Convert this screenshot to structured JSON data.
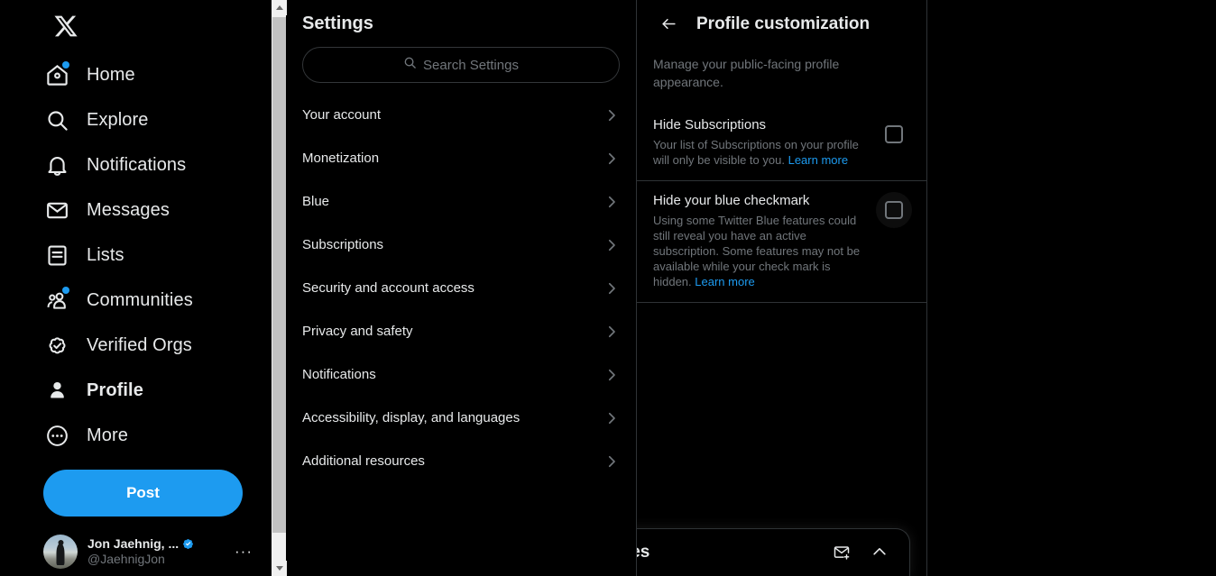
{
  "brand": {
    "logo": "x-logo",
    "accent": "#1d9bf0"
  },
  "sidebar": {
    "items": [
      {
        "label": "Home",
        "icon": "home-icon",
        "badge": true,
        "active": false
      },
      {
        "label": "Explore",
        "icon": "search-icon",
        "badge": false,
        "active": false
      },
      {
        "label": "Notifications",
        "icon": "bell-icon",
        "badge": false,
        "active": false
      },
      {
        "label": "Messages",
        "icon": "envelope-icon",
        "badge": false,
        "active": false
      },
      {
        "label": "Lists",
        "icon": "list-icon",
        "badge": false,
        "active": false
      },
      {
        "label": "Communities",
        "icon": "communities-icon",
        "badge": true,
        "active": false
      },
      {
        "label": "Verified Orgs",
        "icon": "verified-badge-icon",
        "badge": false,
        "active": false
      },
      {
        "label": "Profile",
        "icon": "person-icon",
        "badge": false,
        "active": true
      },
      {
        "label": "More",
        "icon": "more-circle-icon",
        "badge": false,
        "active": false
      }
    ],
    "post_button": "Post",
    "account": {
      "name": "Jon Jaehnig, ...",
      "handle": "@JaehnigJon",
      "verified": true,
      "more": "···"
    }
  },
  "settings": {
    "title": "Settings",
    "search_placeholder": "Search Settings",
    "items": [
      {
        "label": "Your account"
      },
      {
        "label": "Monetization"
      },
      {
        "label": "Blue"
      },
      {
        "label": "Subscriptions"
      },
      {
        "label": "Security and account access"
      },
      {
        "label": "Privacy and safety"
      },
      {
        "label": "Notifications"
      },
      {
        "label": "Accessibility, display, and languages"
      },
      {
        "label": "Additional resources"
      }
    ]
  },
  "main": {
    "back_label": "Back",
    "title": "Profile customization",
    "description": "Manage your public-facing profile appearance.",
    "options": [
      {
        "title": "Hide Subscriptions",
        "description": "Your list of Subscriptions on your profile will only be visible to you.",
        "link": "Learn more",
        "checked": false
      },
      {
        "title": "Hide your blue checkmark",
        "description": "Using some Twitter Blue features could still reveal you have an active subscription. Some features may not be available while your check mark is hidden.",
        "link": "Learn more",
        "checked": false
      }
    ]
  },
  "messages_dock": {
    "title": "Messages",
    "new_message_icon": "new-message-icon",
    "expand_icon": "chevron-up-icon"
  }
}
